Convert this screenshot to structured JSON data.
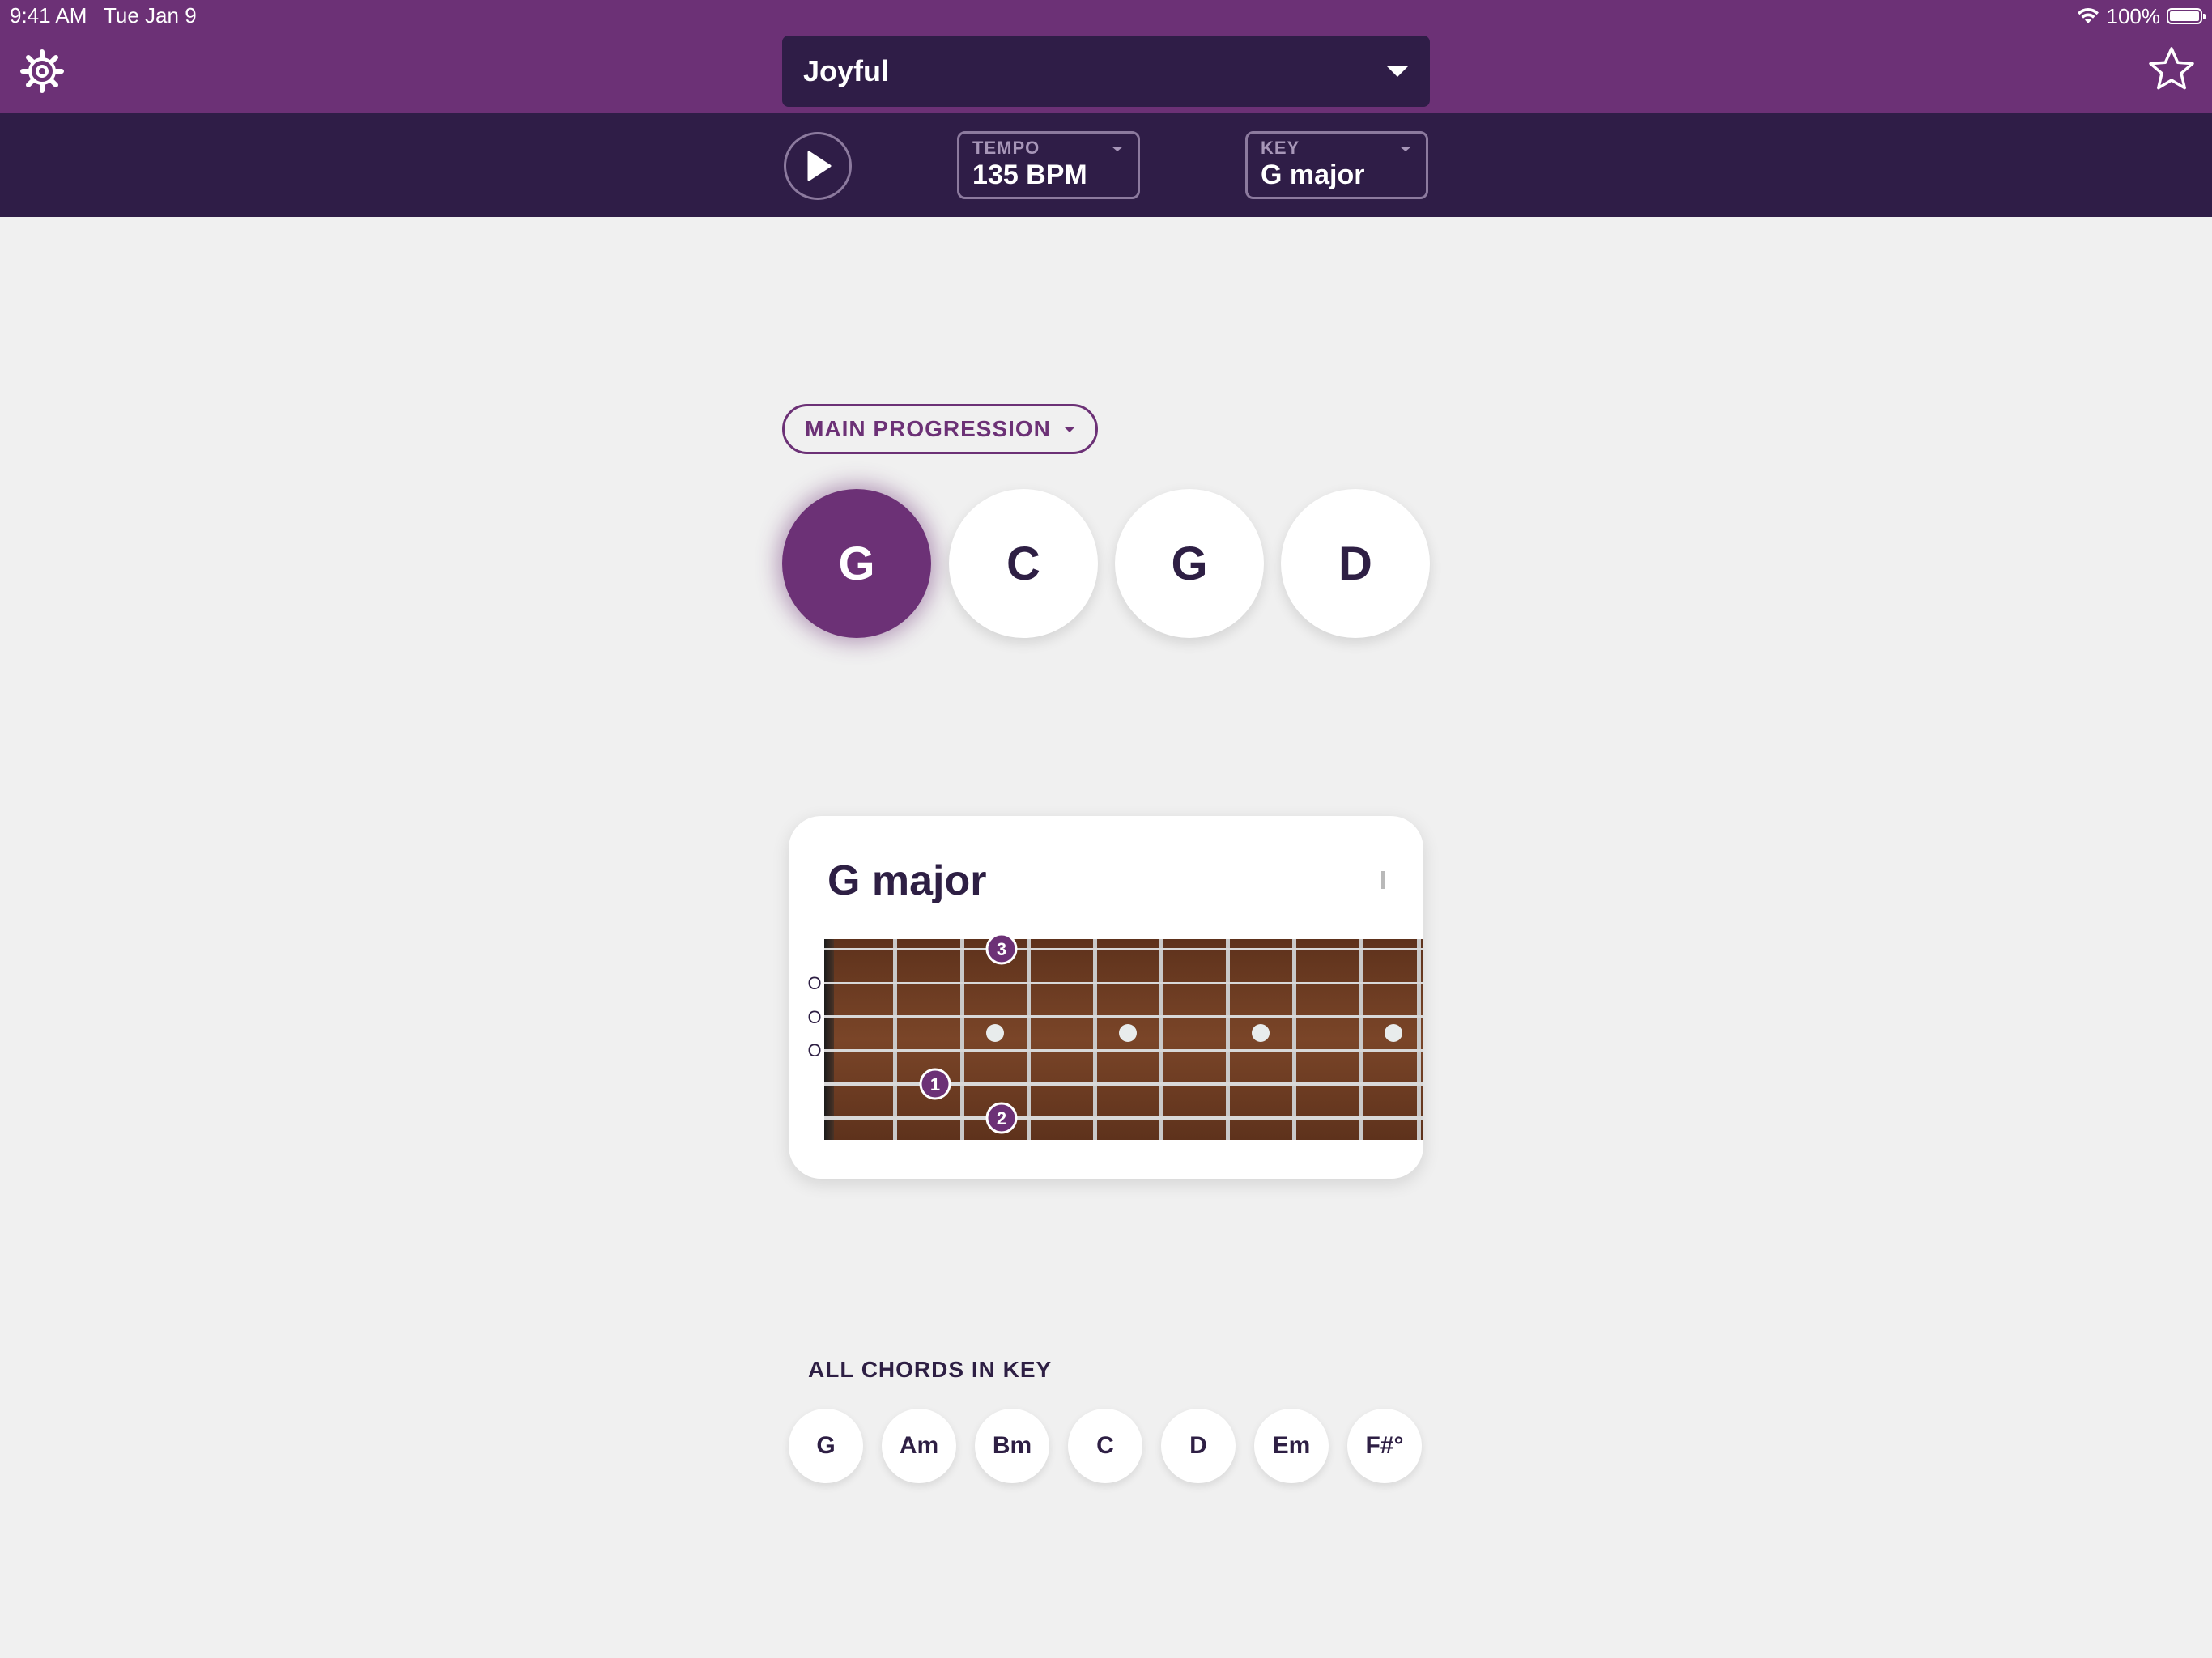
{
  "status_bar": {
    "time": "9:41 AM",
    "date": "Tue Jan 9",
    "battery": "100%"
  },
  "header": {
    "song": "Joyful",
    "icons": {
      "settings": "gear-icon",
      "favorite": "star-icon",
      "dropdown": "caret-down-icon"
    }
  },
  "toolbar": {
    "play_icon": "play-icon",
    "tempo": {
      "label": "TEMPO",
      "value": "135 BPM"
    },
    "key": {
      "label": "KEY",
      "value": "G major"
    }
  },
  "progression": {
    "selector": "MAIN PROGRESSION",
    "chords": [
      "G",
      "C",
      "G",
      "D"
    ],
    "active_index": 0
  },
  "chord_card": {
    "title": "G major",
    "open_string_markers": [
      "O",
      "O",
      "O"
    ],
    "fingers": [
      {
        "label": "3",
        "string": 1,
        "fret": 3
      },
      {
        "label": "1",
        "string": 5,
        "fret": 2
      },
      {
        "label": "2",
        "string": 6,
        "fret": 3
      }
    ],
    "inlay_frets": [
      3,
      5,
      7,
      9
    ]
  },
  "key_chords": {
    "label": "ALL CHORDS IN KEY",
    "chords": [
      "G",
      "Am",
      "Bm",
      "C",
      "D",
      "Em",
      "F#°"
    ]
  },
  "colors": {
    "primary": "#6c3176",
    "dark": "#2f1d47",
    "background": "#f0f0f0",
    "fretboard": "#6b3a22"
  }
}
